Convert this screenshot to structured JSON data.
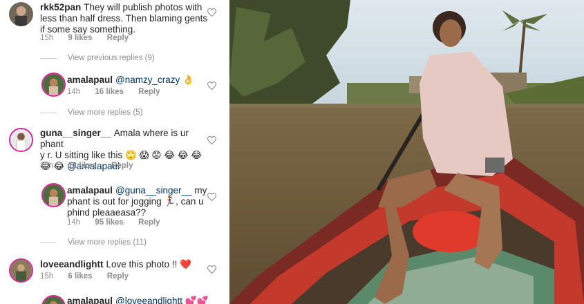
{
  "comments": [
    {
      "username": "rkk52pan",
      "text": "They will publish photos with less than half dress. Then blaming gents if some say something.",
      "time": "15h",
      "likes": "9 likes",
      "reply": "Reply"
    },
    {
      "view_label": "View previous replies (9)"
    },
    {
      "username": "amalapaul",
      "mention": "@namzy_crazy",
      "emoji": "👌",
      "time": "14h",
      "likes": "16 likes",
      "reply": "Reply"
    },
    {
      "view_label": "View more replies (5)"
    },
    {
      "username": "guna__singer__",
      "text_line1": "Amala where is ur phant",
      "text_line2": "y r. U sitting like this 🙄 😱 😟 😂 😂 😂",
      "text_line3_emoji": "😂 😂",
      "mention": "@amalapaul",
      "time": "15h",
      "likes": "12 likes",
      "reply": "Reply"
    },
    {
      "username": "amalapaul",
      "mention": "@guna__singer__",
      "text_line1": "my",
      "text_line2": "phant is out for jogging 🏃‍♀️, can u",
      "text_line3": "phind pleaaeasa??",
      "time": "14h",
      "likes": "95 likes",
      "reply": "Reply"
    },
    {
      "view_label": "View more replies (11)"
    },
    {
      "username": "loveeandlightt",
      "text": "Love this photo !! ❤️",
      "time": "15h",
      "likes": "6 likes",
      "reply": "Reply"
    },
    {
      "username": "amalapaul",
      "mention": "@loveeandlightt",
      "emoji": "💕💕"
    }
  ],
  "colors": {
    "mention": "#003569",
    "meta": "#8e8e8e",
    "story_ring": "#d6249f"
  }
}
